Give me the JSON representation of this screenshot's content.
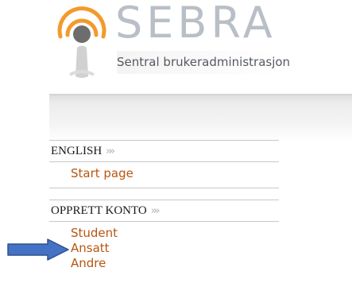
{
  "logo": {
    "title": "SEBRA",
    "subtitle": "Sentral brukeradministrasjon",
    "mark_icon": "sebra-logo-icon"
  },
  "menu": {
    "sections": [
      {
        "header": "ENGLISH",
        "links": [
          "Start page"
        ]
      },
      {
        "header": "OPPRETT KONTO",
        "links": [
          "Student",
          "Ansatt",
          "Andre"
        ]
      }
    ],
    "chevron": "»"
  },
  "annotation": {
    "icon": "blue-arrow-icon",
    "color": "#4472c4"
  },
  "colors": {
    "link": "#b8560f",
    "logo_orange": "#f39a2c",
    "logo_gray": "#b9bfc6"
  }
}
